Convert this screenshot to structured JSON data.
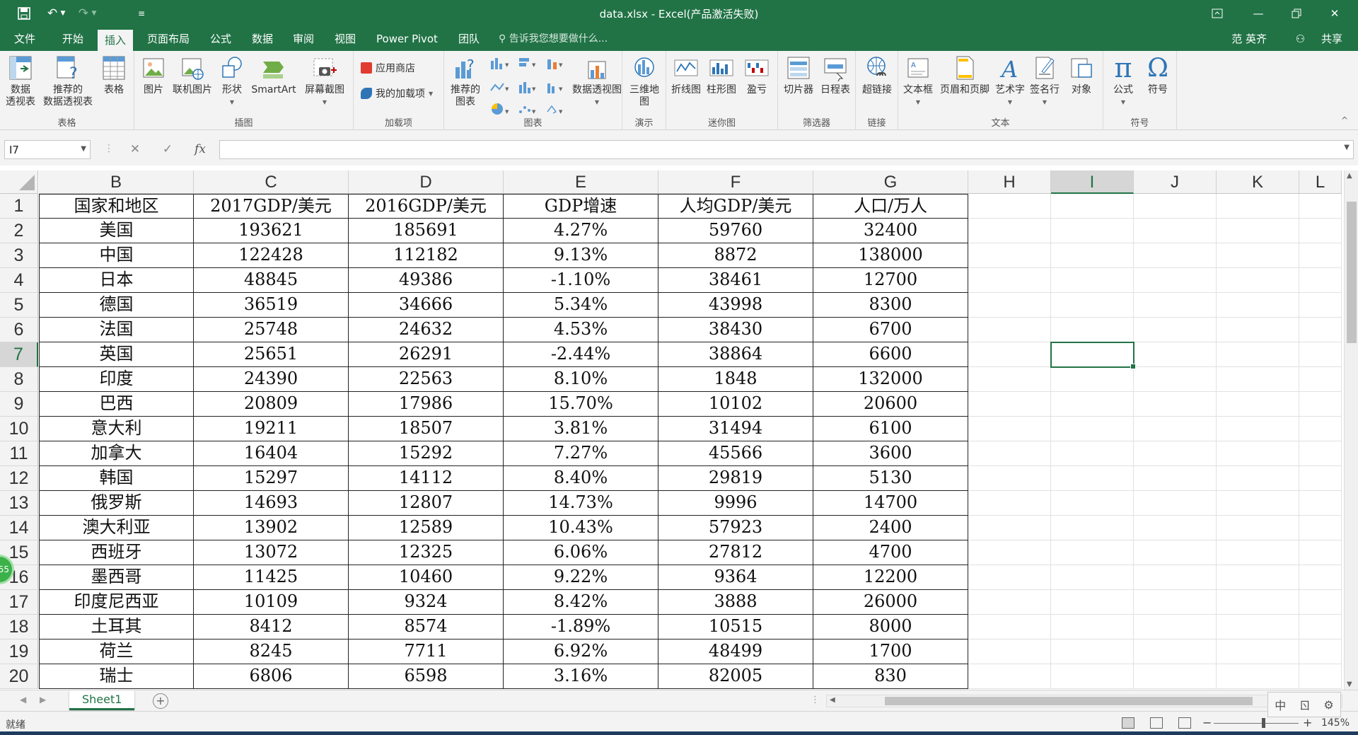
{
  "titlebar": {
    "title": "data.xlsx - Excel(产品激活失败)"
  },
  "tabs": [
    "文件",
    "开始",
    "插入",
    "页面布局",
    "公式",
    "数据",
    "审阅",
    "视图",
    "Power Pivot",
    "团队"
  ],
  "active_tab": "插入",
  "tell_me": "告诉我您想要做什么...",
  "user": {
    "name": "范 英齐",
    "share": "共享"
  },
  "ribbon": {
    "groups": {
      "tables": "表格",
      "illustrations": "插图",
      "addins": "加载项",
      "charts": "图表",
      "tours": "演示",
      "sparklines": "迷你图",
      "filters": "筛选器",
      "links": "链接",
      "text": "文本",
      "symbols": "符号"
    },
    "buttons": {
      "pivot_table": "数据\n透视表",
      "recommended_pivot": "推荐的\n数据透视表",
      "table": "表格",
      "picture": "图片",
      "online_picture": "联机图片",
      "shapes": "形状",
      "smartart": "SmartArt",
      "screenshot": "屏幕截图",
      "store": "应用商店",
      "my_addins": "我的加载项",
      "recommended_charts": "推荐的\n图表",
      "pivot_chart": "数据透视图",
      "map_3d": "三维地\n图",
      "line_spark": "折线图",
      "column_spark": "柱形图",
      "winloss_spark": "盈亏",
      "slicer": "切片器",
      "timeline": "日程表",
      "hyperlink": "超链接",
      "textbox": "文本框",
      "header_footer": "页眉和页脚",
      "wordart": "艺术字",
      "signature": "签名行",
      "object": "对象",
      "equation": "公式",
      "symbol": "符号"
    }
  },
  "formula_bar": {
    "name_box": "I7",
    "formula": ""
  },
  "sheet": {
    "columns": [
      "B",
      "C",
      "D",
      "E",
      "F",
      "G",
      "H",
      "I",
      "J",
      "K",
      "L"
    ],
    "selected_column": "I",
    "selected_row": 7,
    "rows": [
      [
        "国家和地区",
        "2017GDP/美元",
        "2016GDP/美元",
        "GDP增速",
        "人均GDP/美元",
        "人口/万人"
      ],
      [
        "美国",
        "193621",
        "185691",
        "4.27%",
        "59760",
        "32400"
      ],
      [
        "中国",
        "122428",
        "112182",
        "9.13%",
        "8872",
        "138000"
      ],
      [
        "日本",
        "48845",
        "49386",
        "-1.10%",
        "38461",
        "12700"
      ],
      [
        "德国",
        "36519",
        "34666",
        "5.34%",
        "43998",
        "8300"
      ],
      [
        "法国",
        "25748",
        "24632",
        "4.53%",
        "38430",
        "6700"
      ],
      [
        "英国",
        "25651",
        "26291",
        "-2.44%",
        "38864",
        "6600"
      ],
      [
        "印度",
        "24390",
        "22563",
        "8.10%",
        "1848",
        "132000"
      ],
      [
        "巴西",
        "20809",
        "17986",
        "15.70%",
        "10102",
        "20600"
      ],
      [
        "意大利",
        "19211",
        "18507",
        "3.81%",
        "31494",
        "6100"
      ],
      [
        "加拿大",
        "16404",
        "15292",
        "7.27%",
        "45566",
        "3600"
      ],
      [
        "韩国",
        "15297",
        "14112",
        "8.40%",
        "29819",
        "5130"
      ],
      [
        "俄罗斯",
        "14693",
        "12807",
        "14.73%",
        "9996",
        "14700"
      ],
      [
        "澳大利亚",
        "13902",
        "12589",
        "10.43%",
        "57923",
        "2400"
      ],
      [
        "西班牙",
        "13072",
        "12325",
        "6.06%",
        "27812",
        "4700"
      ],
      [
        "墨西哥",
        "11425",
        "10460",
        "9.22%",
        "9364",
        "12200"
      ],
      [
        "印度尼西亚",
        "10109",
        "9324",
        "8.42%",
        "3888",
        "26000"
      ],
      [
        "土耳其",
        "8412",
        "8574",
        "-1.89%",
        "10515",
        "8000"
      ],
      [
        "荷兰",
        "8245",
        "7711",
        "6.92%",
        "48499",
        "1700"
      ],
      [
        "瑞士",
        "6806",
        "6598",
        "3.16%",
        "82005",
        "830"
      ]
    ]
  },
  "sheet_tab": "Sheet1",
  "status": {
    "text": "就绪",
    "zoom": "145%"
  },
  "ime": [
    "中",
    "ㄖ",
    "⚙"
  ],
  "float_badge": "55",
  "colors": {
    "accent": "#217346",
    "ribbon_bg": "#f3f3f3"
  }
}
